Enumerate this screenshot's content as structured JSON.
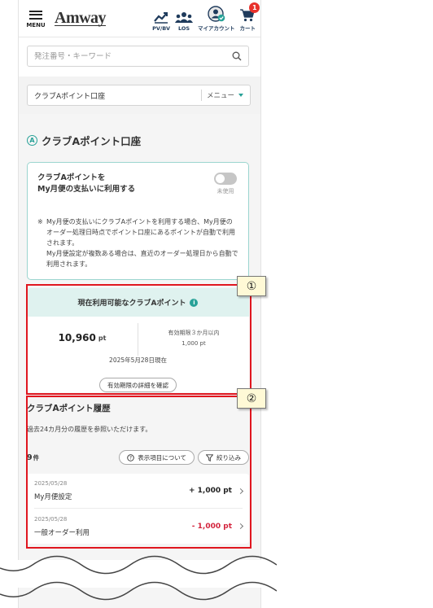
{
  "header": {
    "menu_label": "MENU",
    "logo": "Amway",
    "pvbv_label": "PV/BV",
    "los_label": "LOS",
    "account_label": "マイアカウント",
    "cart_label": "カート",
    "cart_count": "1"
  },
  "search": {
    "placeholder": "発注番号・キーワード"
  },
  "submenu": {
    "title": "クラブAポイント口座",
    "menu_label": "メニュー"
  },
  "page": {
    "title": "クラブAポイント口座",
    "title_icon_letter": "A"
  },
  "toggle_card": {
    "title_line1": "クラブAポイントを",
    "title_line2": "My月便の支払いに利用する",
    "status": "未使用",
    "note_mark": "※",
    "note_p1": "My月便の支払いにクラブAポイントを利用する場合、My月便のオーダー処理日時点でポイント口座にあるポイントが自動で利用されます。",
    "note_p2": "My月便設定が複数ある場合は、直近のオーダー処理日から自動で利用されます。"
  },
  "points_card": {
    "heading": "現在利用可能なクラブAポイント",
    "info_icon": "i",
    "points": "10,960",
    "unit": "pt",
    "expiry_label": "有効期限３か月以内",
    "expiry_value": "1,000 pt",
    "as_of": "2025年5月28日現在",
    "details_button": "有効期限の詳細を確認"
  },
  "history": {
    "title": "クラブAポイント履歴",
    "description": "過去24カ月分の履歴を参照いただけます。",
    "count": "9",
    "count_unit": "件",
    "display_items_button": "表示項目について",
    "filter_button": "絞り込み",
    "rows": [
      {
        "date": "2025/05/28",
        "name": "My月便設定",
        "amount": "+ 1,000 pt"
      },
      {
        "date": "2025/05/28",
        "name": "一般オーダー利用",
        "amount": "- 1,000 pt"
      }
    ]
  },
  "annotations": {
    "callout_1": "①",
    "callout_2": "②"
  },
  "colors": {
    "accent": "#27a197",
    "highlight": "#e0161f",
    "negative": "#d3233c"
  }
}
